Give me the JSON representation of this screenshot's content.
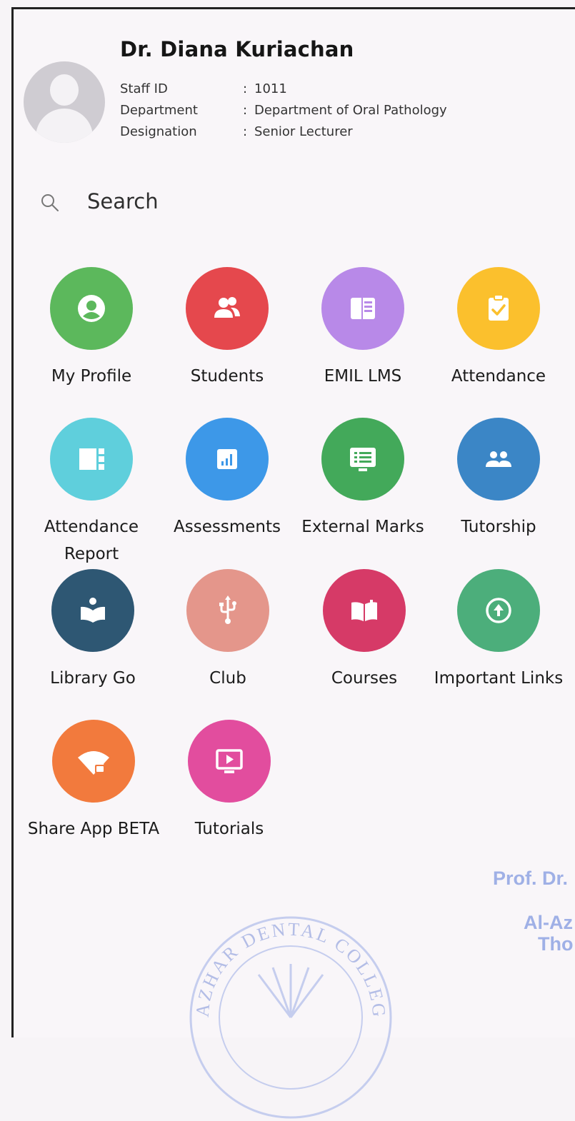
{
  "profile": {
    "name": "Dr. Diana Kuriachan",
    "fields": [
      {
        "label": "Staff ID",
        "sep": ":",
        "value": "1011"
      },
      {
        "label": "Department",
        "sep": ":",
        "value": "Department of Oral Pathology"
      },
      {
        "label": "Designation",
        "sep": ":",
        "value": "Senior Lecturer"
      }
    ]
  },
  "search": {
    "placeholder": "Search",
    "icon": "search-icon"
  },
  "tiles": [
    {
      "label": "My Profile",
      "color": "#5cb85c",
      "icon": "user-circle-icon"
    },
    {
      "label": "Students",
      "color": "#e5484d",
      "icon": "users-icon"
    },
    {
      "label": "EMIL LMS",
      "color": "#b889e8",
      "icon": "book-page-icon"
    },
    {
      "label": "Attendance",
      "color": "#fbc02d",
      "icon": "clipboard-check-icon"
    },
    {
      "label": "Attendance Report",
      "color": "#5fcfdc",
      "icon": "report-icon"
    },
    {
      "label": "Assessments",
      "color": "#3d98e8",
      "icon": "bar-chart-icon"
    },
    {
      "label": "External Marks",
      "color": "#43a95a",
      "icon": "monitor-list-icon"
    },
    {
      "label": "Tutorship",
      "color": "#3b86c6",
      "icon": "group-icon"
    },
    {
      "label": "Library Go",
      "color": "#2e5773",
      "icon": "reader-icon"
    },
    {
      "label": "Club",
      "color": "#e4968b",
      "icon": "usb-icon"
    },
    {
      "label": "Courses",
      "color": "#d63a67",
      "icon": "open-book-icon"
    },
    {
      "label": "Important Links",
      "color": "#4cae7b",
      "icon": "arrow-up-circle-icon"
    },
    {
      "label": "Share App BETA",
      "color": "#f27a3d",
      "icon": "wifi-lock-icon"
    },
    {
      "label": "Tutorials",
      "color": "#e24d9e",
      "icon": "play-screen-icon"
    }
  ],
  "stamp": {
    "line1": "Prof. Dr.",
    "line2": "Al-Az",
    "line3": "Tho",
    "seal_text": "AZHAR DENTAL COLLEGE"
  }
}
